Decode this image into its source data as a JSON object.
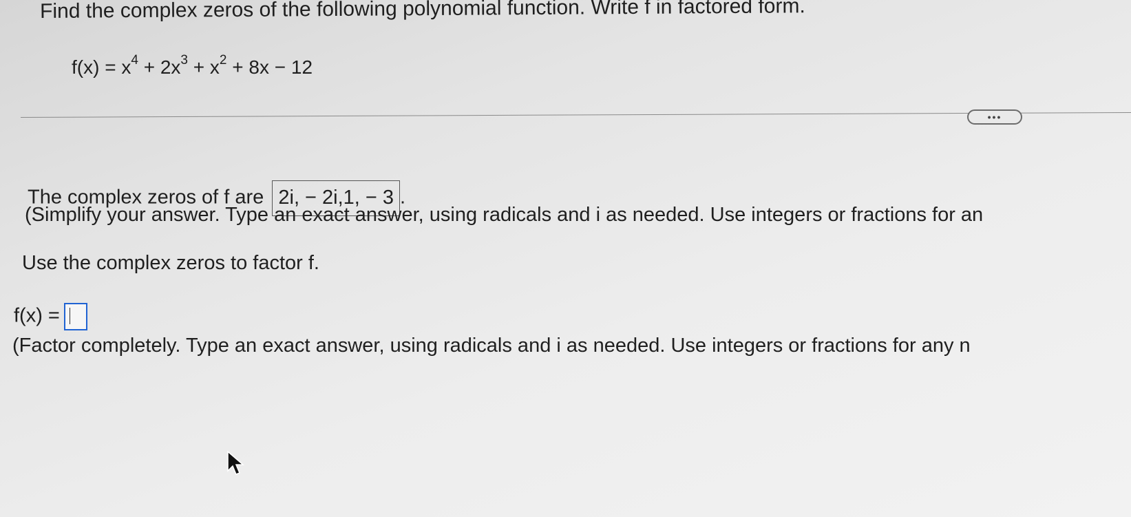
{
  "question": {
    "title": "Find the complex zeros of the following polynomial function. Write f in factored form.",
    "function": {
      "lhs": "f(x) = ",
      "t1_base": "x",
      "t1_exp": "4",
      "t2_prefix": " + 2x",
      "t2_exp": "3",
      "t3_prefix": " + x",
      "t3_exp": "2",
      "tail": " + 8x − 12"
    }
  },
  "more_button": {
    "label": "•••"
  },
  "part1": {
    "prefix": "The complex zeros of f are ",
    "answer": "2i, − 2i,1, − 3",
    "suffix": ".",
    "hint": "(Simplify your answer. Type an exact answer, using radicals and i as needed. Use integers or fractions for an"
  },
  "part2": {
    "instruction": "Use the complex zeros to factor f.",
    "lhs": "f(x) =",
    "answer": "",
    "hint": "(Factor completely. Type an exact answer, using radicals and i as needed. Use integers or fractions for any n"
  },
  "icons": {
    "cursor": "mouse-pointer-icon"
  }
}
